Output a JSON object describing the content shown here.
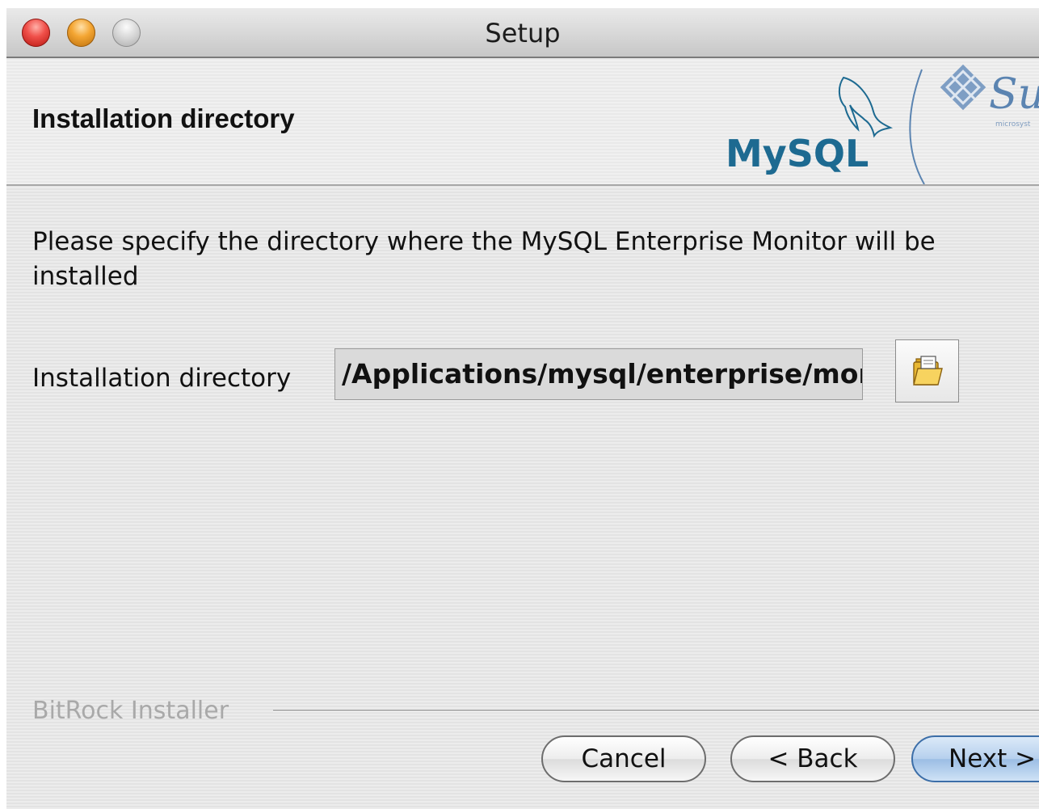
{
  "window": {
    "title": "Setup"
  },
  "header": {
    "title": "Installation directory",
    "logo_mysql": "MySQL",
    "logo_sun": "Su",
    "logo_sun_sub": "microsyst"
  },
  "body": {
    "description": "Please specify the directory where the MySQL Enterprise Monitor will be installed",
    "field_label": "Installation directory",
    "field_value": "/Applications/mysql/enterprise/monit"
  },
  "footer": {
    "brand": "BitRock Installer",
    "cancel_label": "Cancel",
    "back_label": "< Back",
    "next_label": "Next >"
  },
  "colors": {
    "mysql_blue": "#1d6a91",
    "mysql_orange": "#e39418",
    "sun_blue": "#5b84b1",
    "default_button": "#9bbde4"
  }
}
